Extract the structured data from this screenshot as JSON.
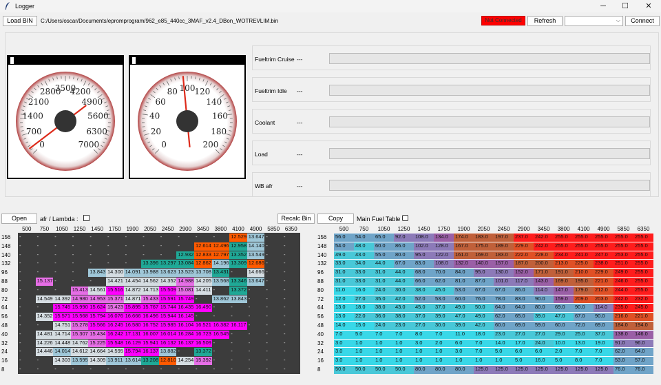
{
  "window": {
    "title": "Logger",
    "minimize": "─",
    "maximize": "☐",
    "close": "✕"
  },
  "toolbar": {
    "load_bin": "Load BIN",
    "file_path": "C:/Users/oscar/Documents/epromprogram/962_e85_440cc_3MAF_v2.4_DBon_WOTREVLIM.bin",
    "status": "Not Connected",
    "refresh": "Refresh",
    "port_selected": "",
    "connect": "Connect"
  },
  "gauges": [
    {
      "name": "rpm",
      "labels": [
        "0",
        "700",
        "1400",
        "2100",
        "2800",
        "3500",
        "4200",
        "4900",
        "5600",
        "6300",
        "7000"
      ],
      "needle_value": 200,
      "max": 7000
    },
    {
      "name": "speed",
      "labels": [
        "0",
        "20",
        "40",
        "60",
        "80",
        "100",
        "120",
        "140",
        "160",
        "180",
        "200"
      ],
      "needle_value": 96,
      "max": 200
    }
  ],
  "sensors": [
    {
      "label": "Fueltrim Cruise",
      "value": "---",
      "level": 0
    },
    {
      "label": "Fueltrim Idle",
      "value": "---",
      "level": 0
    },
    {
      "label": "Coolant",
      "value": "---",
      "level": 0
    },
    {
      "label": "Load",
      "value": "---",
      "level": 0
    },
    {
      "label": "WB afr",
      "value": "---",
      "level": 0
    }
  ],
  "left_controls": {
    "open": "Open",
    "afr_lambda": "afr / Lambda :"
  },
  "right_controls": {
    "recalc": "Recalc Bin",
    "copy": "Copy",
    "main_fuel": "Main Fuel Table"
  },
  "columns": [
    "500",
    "750",
    "1050",
    "1250",
    "1450",
    "1750",
    "1900",
    "2050",
    "2450",
    "2900",
    "3450",
    "3800",
    "4100",
    "4900",
    "5850",
    "6350"
  ],
  "rows": [
    "156",
    "148",
    "140",
    "132",
    "96",
    "88",
    "80",
    "72",
    "64",
    "56",
    "48",
    "40",
    "32",
    "24",
    "16",
    "8"
  ],
  "afr_table": [
    [
      "-",
      "-",
      "-",
      "-",
      "-",
      "-",
      "-",
      "-",
      "-",
      "-",
      "-",
      "-",
      "12.529",
      "13.647",
      "-",
      "-"
    ],
    [
      "-",
      "-",
      "-",
      "-",
      "-",
      "-",
      "-",
      "-",
      "-",
      "-",
      "12.614",
      "12.496",
      "12.958",
      "14.140",
      "-",
      "-"
    ],
    [
      "-",
      "-",
      "-",
      "-",
      "-",
      "-",
      "-",
      "-",
      "-",
      "12.932",
      "12.833",
      "12.797",
      "13.352",
      "13.549",
      "-",
      "-"
    ],
    [
      "-",
      "-",
      "-",
      "-",
      "-",
      "-",
      "-",
      "13.396",
      "13.297",
      "13.084",
      "12.862",
      "14.196",
      "13.309",
      "12.686",
      "-",
      "-"
    ],
    [
      "-",
      "-",
      "-",
      "-",
      "13.843",
      "14.300",
      "14.091",
      "13.988",
      "13.623",
      "13.523",
      "13.708",
      "13.431",
      "-",
      "14.666",
      "-",
      "-"
    ],
    [
      "-",
      "15.137",
      "-",
      "-",
      "-",
      "14.421",
      "14.454",
      "14.562",
      "14.352",
      "14.988",
      "14.205",
      "13.568",
      "13.346",
      "13.647",
      "-",
      "-"
    ],
    [
      "-",
      "-",
      "-",
      "15.413",
      "14.561",
      "15.516",
      "14.872",
      "14.713",
      "15.509",
      "15.081",
      "14.411",
      "-",
      "13.372",
      "-",
      "-",
      "-"
    ],
    [
      "-",
      "14.549",
      "14.392",
      "14.980",
      "14.953",
      "15.371",
      "14.871",
      "15.433",
      "15.591",
      "15.749",
      "-",
      "13.862",
      "13.843",
      "-",
      "-",
      "-"
    ],
    [
      "-",
      "-",
      "15.745",
      "15.990",
      "15.624",
      "15.423",
      "15.895",
      "15.767",
      "15.744",
      "16.435",
      "16.490",
      "-",
      "-",
      "-",
      "-",
      "-"
    ],
    [
      "-",
      "14.352",
      "15.571",
      "15.568",
      "15.794",
      "16.076",
      "16.666",
      "16.496",
      "15.944",
      "16.145",
      "-",
      "-",
      "-",
      "-",
      "-",
      "-"
    ],
    [
      "-",
      "-",
      "14.751",
      "15.278",
      "15.566",
      "16.245",
      "16.580",
      "16.752",
      "15.985",
      "16.104",
      "16.521",
      "16.382",
      "16.117",
      "-",
      "-",
      "-"
    ],
    [
      "-",
      "14.481",
      "14.714",
      "15.307",
      "15.434",
      "16.242",
      "17.131",
      "16.007",
      "16.014",
      "16.284",
      "16.723",
      "16.545",
      "-",
      "-",
      "-",
      "-"
    ],
    [
      "-",
      "14.226",
      "14.448",
      "14.762",
      "15.225",
      "15.548",
      "16.129",
      "15.941",
      "16.132",
      "16.137",
      "16.509",
      "-",
      "-",
      "-",
      "-",
      "-"
    ],
    [
      "-",
      "14.446",
      "14.014",
      "14.612",
      "14.664",
      "14.595",
      "15.794",
      "16.137",
      "13.882",
      "-",
      "13.372",
      "-",
      "-",
      "-",
      "-",
      "-"
    ],
    [
      "-",
      "-",
      "14.303",
      "13.595",
      "14.309",
      "13.911",
      "13.614",
      "13.208",
      "12.810",
      "14.254",
      "15.392",
      "-",
      "-",
      "-",
      "-",
      "-"
    ],
    [
      "-",
      "-",
      "-",
      "-",
      "-",
      "-",
      "-",
      "-",
      "-",
      "-",
      "-",
      "-",
      "-",
      "-",
      "-",
      "-"
    ]
  ],
  "fuel_table": [
    [
      "56.0",
      "54.0",
      "65.0",
      "92.0",
      "108.0",
      "134.0",
      "174.0",
      "183.0",
      "197.0",
      "237.0",
      "242.0",
      "255.0",
      "255.0",
      "255.0",
      "255.0",
      "255.0"
    ],
    [
      "54.0",
      "48.0",
      "60.0",
      "86.0",
      "102.0",
      "128.0",
      "167.0",
      "175.0",
      "189.0",
      "229.0",
      "242.0",
      "255.0",
      "255.0",
      "255.0",
      "255.0",
      "255.0"
    ],
    [
      "49.0",
      "43.0",
      "55.0",
      "80.0",
      "95.0",
      "122.0",
      "161.0",
      "169.0",
      "183.0",
      "222.0",
      "228.0",
      "234.0",
      "241.0",
      "247.0",
      "253.0",
      "255.0"
    ],
    [
      "33.0",
      "34.0",
      "44.0",
      "67.0",
      "83.0",
      "108.0",
      "132.0",
      "140.0",
      "157.0",
      "187.0",
      "200.0",
      "213.0",
      "225.0",
      "238.0",
      "251.0",
      "255.0"
    ],
    [
      "31.0",
      "33.0",
      "31.0",
      "44.0",
      "68.0",
      "70.0",
      "84.0",
      "95.0",
      "130.0",
      "152.0",
      "171.0",
      "191.0",
      "210.0",
      "229.0",
      "249.0",
      "255.0"
    ],
    [
      "31.0",
      "33.0",
      "31.0",
      "44.0",
      "66.0",
      "62.0",
      "81.0",
      "87.0",
      "101.0",
      "117.0",
      "143.0",
      "169.0",
      "195.0",
      "221.0",
      "246.0",
      "255.0"
    ],
    [
      "11.0",
      "16.0",
      "24.0",
      "30.0",
      "38.0",
      "45.0",
      "53.0",
      "67.0",
      "67.0",
      "86.0",
      "114.0",
      "147.0",
      "179.0",
      "212.0",
      "244.0",
      "255.0"
    ],
    [
      "12.0",
      "27.0",
      "35.0",
      "42.0",
      "52.0",
      "53.0",
      "60.0",
      "76.0",
      "78.0",
      "83.0",
      "90.0",
      "159.0",
      "209.0",
      "203.0",
      "242.0",
      "232.0"
    ],
    [
      "13.0",
      "18.0",
      "38.0",
      "43.0",
      "45.0",
      "37.0",
      "49.0",
      "50.0",
      "64.0",
      "64.0",
      "80.0",
      "69.0",
      "90.0",
      "114.0",
      "235.0",
      "245.0"
    ],
    [
      "13.0",
      "22.0",
      "36.0",
      "38.0",
      "37.0",
      "39.0",
      "47.0",
      "49.0",
      "62.0",
      "65.0",
      "39.0",
      "47.0",
      "67.0",
      "90.0",
      "216.0",
      "221.0"
    ],
    [
      "14.0",
      "15.0",
      "24.0",
      "23.0",
      "27.0",
      "30.0",
      "39.0",
      "42.0",
      "60.0",
      "69.0",
      "59.0",
      "60.0",
      "72.0",
      "69.0",
      "184.0",
      "194.0"
    ],
    [
      "7.0",
      "5.0",
      "7.0",
      "7.0",
      "8.0",
      "7.0",
      "11.0",
      "18.0",
      "23.0",
      "27.0",
      "27.0",
      "29.0",
      "25.0",
      "37.0",
      "138.0",
      "146.0"
    ],
    [
      "3.0",
      "1.0",
      "1.0",
      "1.0",
      "3.0",
      "2.0",
      "6.0",
      "7.0",
      "14.0",
      "17.0",
      "24.0",
      "10.0",
      "13.0",
      "19.0",
      "91.0",
      "96.0"
    ],
    [
      "3.0",
      "1.0",
      "1.0",
      "1.0",
      "1.0",
      "1.0",
      "3.0",
      "7.0",
      "5.0",
      "6.0",
      "6.0",
      "2.0",
      "7.0",
      "7.0",
      "62.0",
      "64.0"
    ],
    [
      "3.0",
      "1.0",
      "1.0",
      "1.0",
      "1.0",
      "1.0",
      "1.0",
      "1.0",
      "1.0",
      "5.0",
      "16.0",
      "5.0",
      "8.0",
      "7.0",
      "53.0",
      "57.0"
    ],
    [
      "50.0",
      "50.0",
      "50.0",
      "50.0",
      "80.0",
      "80.0",
      "80.0",
      "125.0",
      "125.0",
      "125.0",
      "125.0",
      "125.0",
      "125.0",
      "125.0",
      "76.0",
      "76.0"
    ]
  ],
  "colors": {
    "not_connected": "#ff0000",
    "table_bg": "#3c3c3c"
  }
}
